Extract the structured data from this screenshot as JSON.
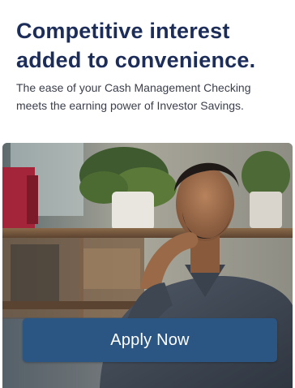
{
  "promo": {
    "headline_line1": "Competitive interest",
    "headline_line2": "added to convenience.",
    "body": "The ease of your Cash Management Checking meets the earning power of Investor Savings.",
    "cta_label": "Apply Now"
  },
  "colors": {
    "headline": "#1d2d5a",
    "cta_background": "#2b5583",
    "cta_text": "#ffffff"
  }
}
